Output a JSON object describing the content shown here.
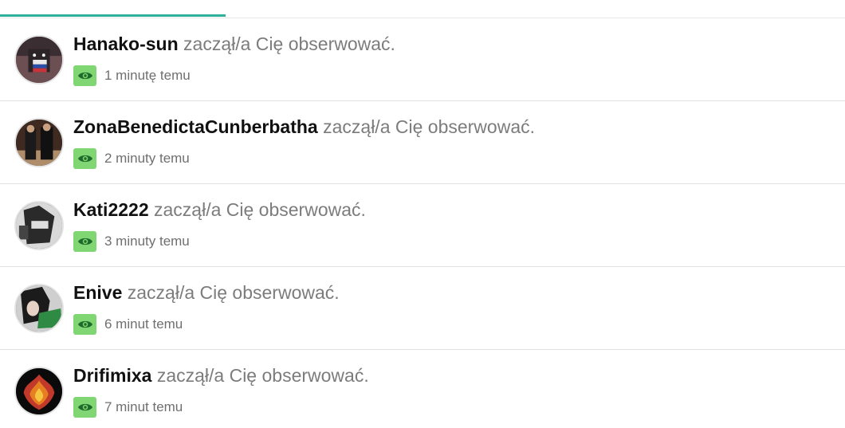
{
  "notifications": [
    {
      "username": "Hanako-sun",
      "action": " zaczął/a Cię obserwować.",
      "time": "1 minutę temu",
      "avatar_icon": "avatar-image"
    },
    {
      "username": "ZonaBenedictaCunberbatha",
      "action": " zaczął/a Cię obserwować.",
      "time": "2 minuty temu",
      "avatar_icon": "avatar-image"
    },
    {
      "username": "Kati2222",
      "action": " zaczął/a Cię obserwować.",
      "time": "3 minuty temu",
      "avatar_icon": "avatar-image"
    },
    {
      "username": "Enive",
      "action": " zaczął/a Cię obserwować.",
      "time": "6 minut temu",
      "avatar_icon": "avatar-image"
    },
    {
      "username": "Drifimixa",
      "action": " zaczął/a Cię obserwować.",
      "time": "7 minut temu",
      "avatar_icon": "avatar-image"
    }
  ],
  "colors": {
    "accent": "#2eb09b",
    "badge": "#80d672",
    "username": "#111111",
    "action": "#7c7c7c"
  },
  "badge_icon": "eye-icon"
}
